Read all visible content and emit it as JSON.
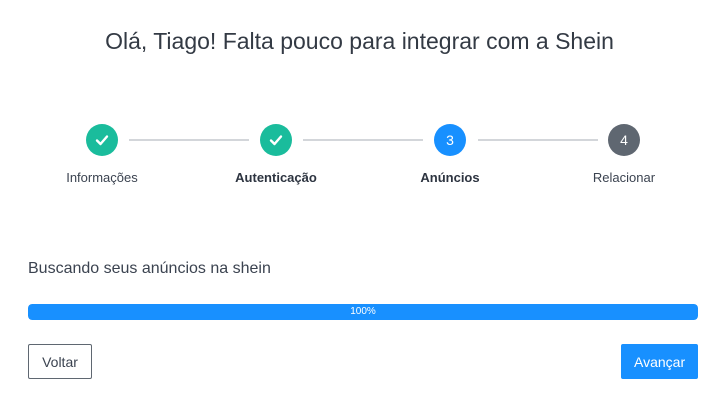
{
  "header": {
    "title": "Olá, Tiago! Falta pouco para integrar com a Shein"
  },
  "stepper": {
    "steps": [
      {
        "label": "Informações",
        "status": "completed",
        "number": "1",
        "bold": false
      },
      {
        "label": "Autenticação",
        "status": "completed",
        "number": "2",
        "bold": true
      },
      {
        "label": "Anúncios",
        "status": "active",
        "number": "3",
        "bold": true
      },
      {
        "label": "Relacionar",
        "status": "pending",
        "number": "4",
        "bold": false
      }
    ]
  },
  "progress": {
    "status_text": "Buscando seus anúncios na shein",
    "value": 1.0,
    "label": "100%"
  },
  "actions": {
    "back_label": "Voltar",
    "next_label": "Avançar"
  },
  "colors": {
    "completed": "#1abc9c",
    "active": "#1890ff",
    "pending": "#5f6771",
    "primary": "#1890ff"
  }
}
